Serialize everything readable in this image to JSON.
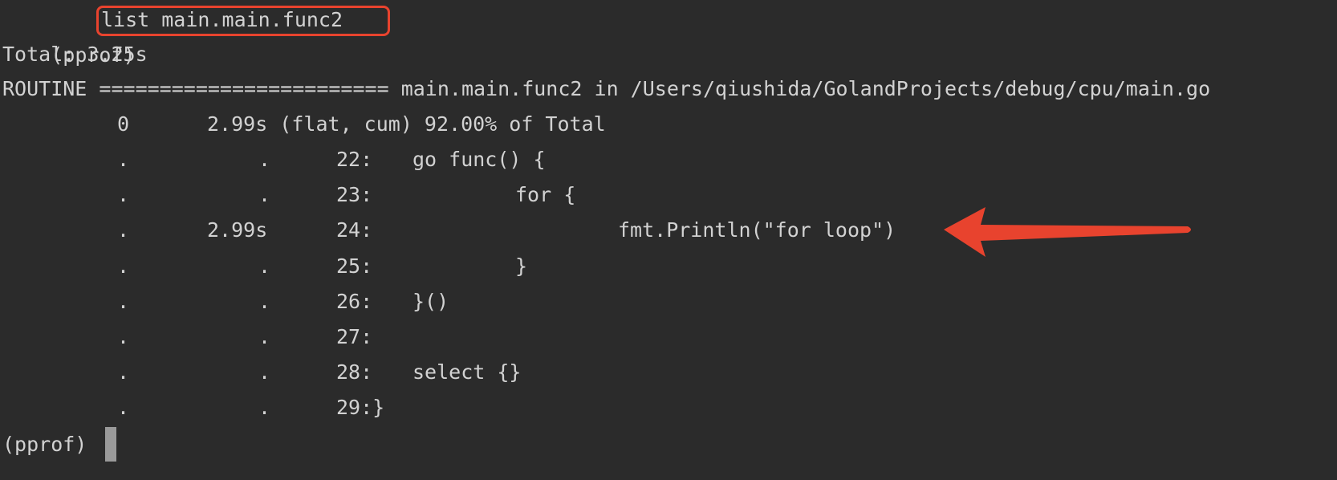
{
  "prompt_label": "(pprof)",
  "command": "list main.main.func2",
  "total_line": "Total: 3.25s",
  "routine_line": "ROUTINE ======================== main.main.func2 in /Users/qiushida/GolandProjects/debug/cpu/main.go",
  "summary": {
    "flat": "0",
    "cum": "2.99s (flat, cum) 92.00% of Total"
  },
  "rows": [
    {
      "flat": ".",
      "cum": ".",
      "lineno": "22:",
      "code": "go func() {"
    },
    {
      "flat": ".",
      "cum": ".",
      "lineno": "23:",
      "code": "for {"
    },
    {
      "flat": ".",
      "cum": "2.99s",
      "lineno": "24:",
      "code": "fmt.Println(\"for loop\")"
    },
    {
      "flat": ".",
      "cum": ".",
      "lineno": "25:",
      "code": "}"
    },
    {
      "flat": ".",
      "cum": ".",
      "lineno": "26:",
      "code": "}()"
    },
    {
      "flat": ".",
      "cum": ".",
      "lineno": "27:",
      "code": ""
    },
    {
      "flat": ".",
      "cum": ".",
      "lineno": "28:",
      "code": "select {}"
    },
    {
      "flat": ".",
      "cum": ".",
      "lineno": "29:}",
      "code": ""
    }
  ],
  "final_prompt": "(pprof)",
  "colors": {
    "background": "#2b2b2b",
    "text": "#d2d2d2",
    "annotation": "#e8432e",
    "cursor": "#9a9a9a"
  }
}
